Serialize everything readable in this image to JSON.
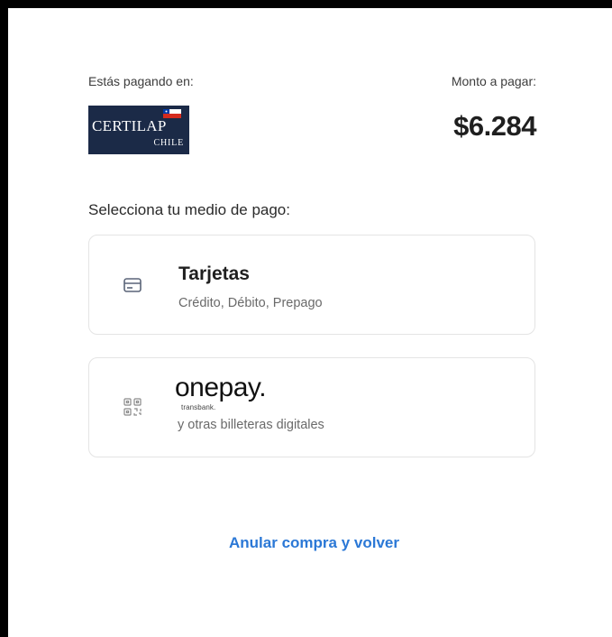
{
  "merchant": {
    "label": "Estás pagando en:",
    "logo_text_main": "CERTILAP",
    "logo_text_sub": "CHILE"
  },
  "amount": {
    "label": "Monto a pagar:",
    "value": "$6.284"
  },
  "payment": {
    "label": "Selecciona tu medio de pago:",
    "options": [
      {
        "title": "Tarjetas",
        "subtitle": "Crédito, Débito, Prepago",
        "icon": "credit-card-icon"
      },
      {
        "brand": "onepay.",
        "brand_tag": "transbank.",
        "subtitle": "y otras billeteras digitales",
        "icon": "qr-code-icon"
      }
    ]
  },
  "cancel_label": "Anular compra y volver",
  "colors": {
    "link": "#2b78d6",
    "logo_bg": "#1b2a47",
    "text": "#1f1f1f"
  }
}
